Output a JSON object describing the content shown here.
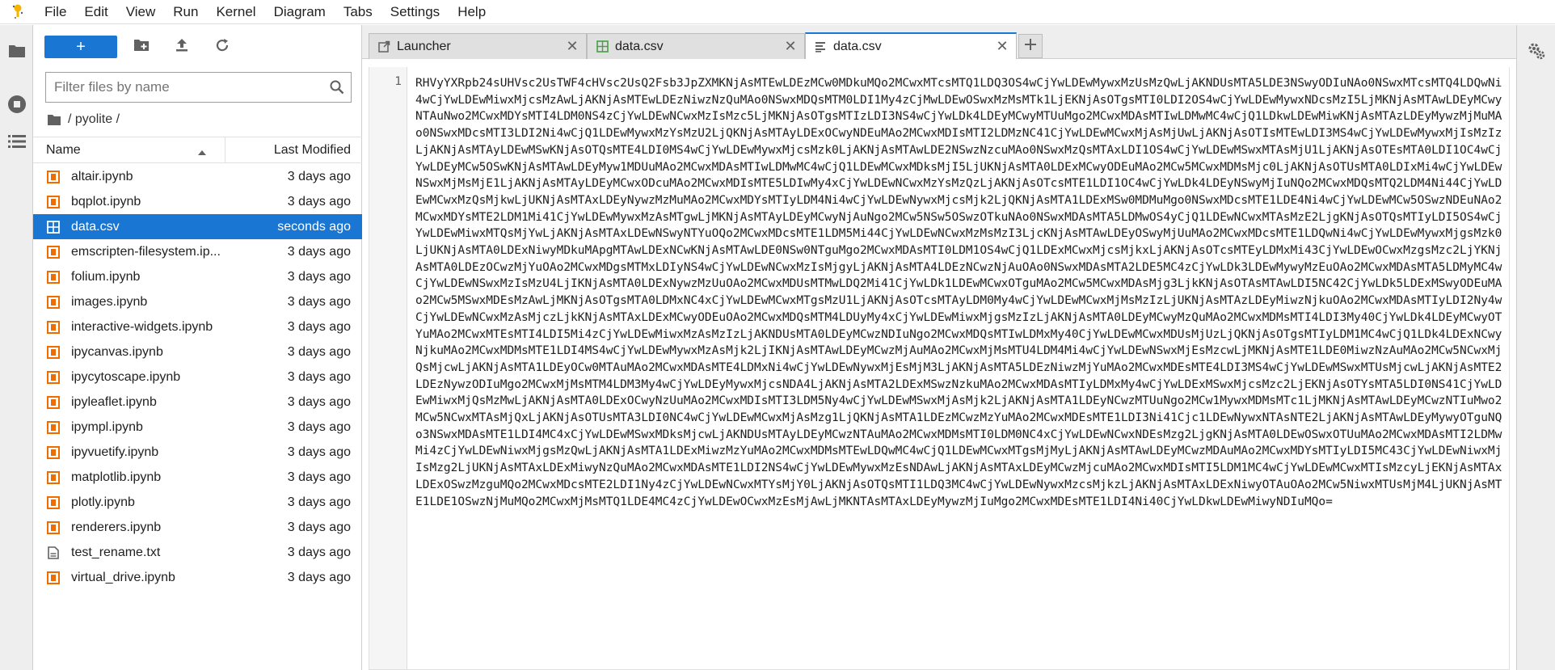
{
  "menubar": {
    "items": [
      "File",
      "Edit",
      "View",
      "Run",
      "Kernel",
      "Diagram",
      "Tabs",
      "Settings",
      "Help"
    ]
  },
  "filebrowser": {
    "new_label": "+",
    "filter_placeholder": "Filter files by name",
    "breadcrumb": "/ pyolite /",
    "columns": {
      "name": "Name",
      "modified": "Last Modified"
    },
    "files": [
      {
        "name": "altair.ipynb",
        "modified": "3 days ago",
        "icon": "notebook-icon"
      },
      {
        "name": "bqplot.ipynb",
        "modified": "3 days ago",
        "icon": "notebook-icon"
      },
      {
        "name": "data.csv",
        "modified": "seconds ago",
        "icon": "spreadsheet-icon"
      },
      {
        "name": "emscripten-filesystem.ip...",
        "modified": "3 days ago",
        "icon": "notebook-icon"
      },
      {
        "name": "folium.ipynb",
        "modified": "3 days ago",
        "icon": "notebook-icon"
      },
      {
        "name": "images.ipynb",
        "modified": "3 days ago",
        "icon": "notebook-icon"
      },
      {
        "name": "interactive-widgets.ipynb",
        "modified": "3 days ago",
        "icon": "notebook-icon"
      },
      {
        "name": "ipycanvas.ipynb",
        "modified": "3 days ago",
        "icon": "notebook-icon"
      },
      {
        "name": "ipycytoscape.ipynb",
        "modified": "3 days ago",
        "icon": "notebook-icon"
      },
      {
        "name": "ipyleaflet.ipynb",
        "modified": "3 days ago",
        "icon": "notebook-icon"
      },
      {
        "name": "ipympl.ipynb",
        "modified": "3 days ago",
        "icon": "notebook-icon"
      },
      {
        "name": "ipyvuetify.ipynb",
        "modified": "3 days ago",
        "icon": "notebook-icon"
      },
      {
        "name": "matplotlib.ipynb",
        "modified": "3 days ago",
        "icon": "notebook-icon"
      },
      {
        "name": "plotly.ipynb",
        "modified": "3 days ago",
        "icon": "notebook-icon"
      },
      {
        "name": "renderers.ipynb",
        "modified": "3 days ago",
        "icon": "notebook-icon"
      },
      {
        "name": "test_rename.txt",
        "modified": "3 days ago",
        "icon": "text-file-icon"
      },
      {
        "name": "virtual_drive.ipynb",
        "modified": "3 days ago",
        "icon": "notebook-icon"
      }
    ]
  },
  "tabs": [
    {
      "label": "Launcher",
      "icon": "launcher-icon"
    },
    {
      "label": "data.csv",
      "icon": "spreadsheet-icon"
    },
    {
      "label": "data.csv",
      "icon": "text-editor-icon"
    }
  ],
  "editor": {
    "line_number": "1",
    "content": "RHVyYXRpb24sUHVsc2UsTWF4cHVsc2UsQ2Fsb3JpZXMKNjAsMTEwLDEzMCw0MDkuMQo2MCwxMTcsMTQ1LDQ3OS4wCjYwLDEwMywxMzUsMzQwLjAKNDUsMTA5LDE3NSwyODIuNAo0NSwxMTcsMTQ4LDQwNi4wCjYwLDEwMiwxMjcsMzAwLjAKNjAsMTEwLDEzNiwzNzQuMAo0NSwxMDQsMTM0LDI1My4zCjMwLDEwOSwxMzMsMTk1LjEKNjAsOTgsMTI0LDI2OS4wCjYwLDEwMywxNDcsMzI5LjMKNjAsMTAwLDEyMCwyNTAuNwo2MCwxMDYsMTI4LDM0NS4zCjYwLDEwNCwxMzIsMzc5LjMKNjAsOTgsMTIzLDI3NS4wCjYwLDk4LDEyMCwyMTUuMgo2MCwxMDAsMTIwLDMwMC4wCjQ1LDkwLDEwMiwKNjAsMTAzLDEyMywzMjMuMAo0NSwxMDcsMTI3LDI2Ni4wCjQ1LDEwMywxMzYsMzU2LjQKNjAsMTAyLDExOCwyNDEuMAo2MCwxMDIsMTI2LDMzNC41CjYwLDEwMCwxMjAsMjUwLjAKNjAsOTIsMTEwLDI3MS4wCjYwLDEwMywxMjIsMzIzLjAKNjAsMTAyLDEwMSwKNjAsOTQsMTE4LDI0MS4wCjYwLDEwMywxMjcsMzk0LjAKNjAsMTAwLDE2NSwzNzcuMAo0NSwxMzQsMTAxLDI1OS4wCjYwLDEwMSwxMTAsMjU1LjAKNjAsOTEsMTA0LDI1OC4wCjYwLDEyMCw5OSwKNjAsMTAwLDEyMyw1MDUuMAo2MCwxMDAsMTIwLDMwMC4wCjQ1LDEwMCwxMDksMjI5LjUKNjAsMTA0LDExMCwyODEuMAo2MCw5MCwxMDMsMjc0LjAKNjAsOTUsMTA0LDIxMi4wCjYwLDEwNSwxMjMsMjE1LjAKNjAsMTAyLDEyMCwxODcuMAo2MCwxMDIsMTE5LDIwMy4xCjYwLDEwNCwxMzYsMzQzLjAKNjAsOTcsMTE1LDI1OC4wCjYwLDk4LDEyNSwyMjIuNQo2MCwxMDQsMTQ2LDM4Ni44CjYwLDEwMCwxMzQsMjkwLjUKNjAsMTAxLDEyNywzMzMuMAo2MCwxMDYsMTIyLDM4Ni4wCjYwLDEwNywxMjcsMjk2LjQKNjAsMTA1LDExMSw0MDMuMgo0NSwxMDcsMTE1LDE4Ni4wCjYwLDEwMCw5OSwzNDEuNAo2MCwxMDYsMTE2LDM1Mi41CjYwLDEwMywxMzAsMTgwLjMKNjAsMTAyLDEyMCwyNjAuNgo2MCw5NSw5OSwzOTkuNAo0NSwxMDAsMTA5LDMwOS4yCjQ1LDEwNCwxMTAsMzE2LjgKNjAsOTQsMTIyLDI5OS4wCjYwLDEwMiwxMTQsMjYwLjAKNjAsMTAxLDEwNSwyNTYuOQo2MCwxMDcsMTE1LDM5Mi44CjYwLDEwNCwxMzMsMzI3LjcKNjAsMTAwLDEyOSwyMjUuMAo2MCwxMDcsMTE1LDQwNi4wCjYwLDEwMywxMjgsMzk0LjUKNjAsMTA0LDExNiwyMDkuMApgMTAwLDExNCwKNjAsMTAwLDE0NSw0NTguMgo2MCwxMDAsMTI0LDM1OS4wCjQ1LDExMCwxMjcsMjkxLjAKNjAsOTcsMTEyLDMxMi43CjYwLDEwOCwxMzgsMzc2LjYKNjAsMTA0LDEzOCwzMjYuOAo2MCwxMDgsMTMxLDIyNS4wCjYwLDEwNCwxMzIsMjgyLjAKNjAsMTA4LDEzNCwzNjAuOAo0NSwxMDAsMTA2LDE5MC4zCjYwLDk3LDEwMywyMzEuOAo2MCwxMDAsMTA5LDMyMC4wCjYwLDEwNSwxMzIsMzU4LjIKNjAsMTA0LDExNywzMzUuOAo2MCwxMDUsMTMwLDQ2Mi41CjYwLDk1LDEwMCwxOTguMAo2MCw5MCwxMDAsMjg3LjkKNjAsOTAsMTAwLDI5NC42CjYwLDk5LDExMSwyODEuMAo2MCw5MSwxMDEsMzAwLjMKNjAsOTgsMTA0LDMxNC4xCjYwLDEwMCwxMTgsMzU1LjAKNjAsOTcsMTAyLDM0My4wCjYwLDEwMCwxMjMsMzIzLjUKNjAsMTAzLDEyMiwzNjkuOAo2MCwxMDAsMTIyLDI2Ny4wCjYwLDEwNCwxMzAsMjczLjkKNjAsMTAxLDExMCwyODEuOAo2MCwxMDQsMTM4LDUyMy4xCjYwLDEwMiwxMjgsMzIzLjAKNjAsMTA0LDEyMCwyMzQuMAo2MCwxMDMsMTI4LDI3My40CjYwLDk4LDEyMCwyOTYuMAo2MCwxMTEsMTI4LDI5Mi4zCjYwLDEwMiwxMzAsMzIzLjAKNDUsMTA0LDEyMCwzNDIuNgo2MCwxMDQsMTIwLDMxMy40CjYwLDEwMCwxMDUsMjUzLjQKNjAsOTgsMTIyLDM1MC4wCjQ1LDk4LDExNCwyNjkuMAo2MCwxMDMsMTE1LDI4MS4wCjYwLDEwMywxMzAsMjk2LjIKNjAsMTAwLDEyMCwzMjAuMAo2MCwxMjMsMTU4LDM4Mi4wCjYwLDEwNSwxMjEsMzcwLjMKNjAsMTE1LDE0MiwzNzAuMAo2MCw5NCwxMjQsMjcwLjAKNjAsMTA1LDEyOCw0MTAuMAo2MCwxMDAsMTE4LDMxNi4wCjYwLDEwNywxMjEsMjM3LjAKNjAsMTA5LDEzNiwzMjYuMAo2MCwxMDEsMTE4LDI3MS4wCjYwLDEwMSwxMTUsMjcwLjAKNjAsMTE2LDEzNywzODIuMgo2MCwxMjMsMTM4LDM3My4wCjYwLDEyMywxMjcsNDA4LjAKNjAsMTA2LDExMSwzNzkuMAo2MCwxMDAsMTIyLDMxMy4wCjYwLDExMSwxMjcsMzc2LjEKNjAsOTYsMTA5LDI0NS41CjYwLDEwMiwxMjQsMzMwLjAKNjAsMTA0LDExOCwyNzUuMAo2MCwxMDIsMTI3LDM5Ny4wCjYwLDEwMSwxMjAsMjk2LjAKNjAsMTA1LDEyNCwzMTUuNgo2MCw1MywxMDMsMTc1LjMKNjAsMTAwLDEyMCwzNTIuMwo2MCw5NCwxMTAsMjQxLjAKNjAsOTUsMTA3LDI0NC4wCjYwLDEwMCwxMjAsMzg1LjQKNjAsMTA1LDEzMCwzMzYuMAo2MCwxMDEsMTE1LDI3Ni41Cjc1LDEwNywxNTAsNTE2LjAKNjAsMTAwLDEyMywyOTguNQo3NSwxMDAsMTE1LDI4MC4xCjYwLDEwMSwxMDksMjcwLjAKNDUsMTAyLDEyMCwzNTAuMAo2MCwxMDMsMTI0LDM0NC4xCjYwLDEwNCwxNDEsMzg2LjgKNjAsMTA0LDEwOSwxOTUuMAo2MCwxMDAsMTI2LDMwMi4zCjYwLDEwNiwxMjgsMzQwLjAKNjAsMTA1LDExMiwzMzYuMAo2MCwxMDMsMTEwLDQwMC4wCjQ1LDEwMCwxMTgsMjMyLjAKNjAsMTAwLDEyMCwzMDAuMAo2MCwxMDYsMTIyLDI5MC43CjYwLDEwNiwxMjIsMzg2LjUKNjAsMTAxLDExMiwyNzQuMAo2MCwxMDAsMTE1LDI2NS4wCjYwLDEwMywxMzEsNDAwLjAKNjAsMTAxLDEyMCwzMjcuMAo2MCwxMDIsMTI5LDM1MC4wCjYwLDEwMCwxMTIsMzcyLjEKNjAsMTAxLDExOSwzMzguMQo2MCwxMDcsMTE2LDI1Ny4zCjYwLDEwNCwxMTYsMjY0LjAKNjAsOTQsMTI1LDQ3MC4wCjYwLDEwNywxMzcsMjkzLjAKNjAsMTAxLDExNiwyOTAuOAo2MCw5NiwxMTUsMjM4LjUKNjAsMTE1LDE1OSwzNjMuMQo2MCwxMjMsMTQ1LDE4MC4zCjYwLDEwOCwxMzEsMjAwLjMKNTAsMTAxLDEyMywzMjIuMgo2MCwxMDEsMTE1LDI4Ni40CjYwLDkwLDEwMiwyNDIuMQo="
  }
}
